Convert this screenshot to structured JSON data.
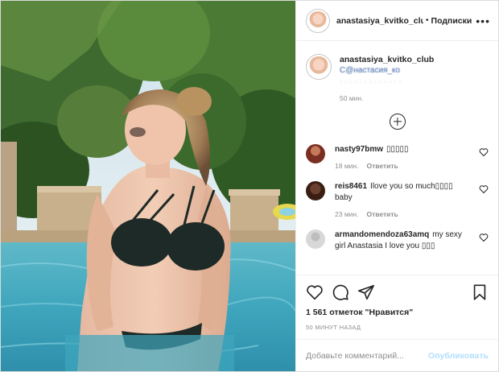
{
  "header": {
    "username": "anastasiya_kvitko_club",
    "separator": "•",
    "follow_label": "Подписки",
    "more_icon": "more-horizontal-icon"
  },
  "caption": {
    "username": "anastasiya_kvitko_club",
    "line1": "С@настасия_ко",
    "line2": "· · · · · · · · · · · · ·",
    "time": "50 мин."
  },
  "load_more_icon": "plus-circle-icon",
  "comments": [
    {
      "user": "nasty97bmw",
      "text": "▯▯▯▯▯",
      "time": "18 мин.",
      "reply": "Ответить",
      "avatar_color": "#7a2f22"
    },
    {
      "user": "reis8461",
      "text": "Ilove you so much▯▯▯▯ baby",
      "time": "23 мин.",
      "reply": "Ответить",
      "avatar_color": "#3b1e12"
    },
    {
      "user": "armandomendoza63amq",
      "text": "my sexy girl Anastasia I love you ▯▯▯",
      "time": "",
      "reply": "",
      "avatar_color": "#d8d8d8"
    }
  ],
  "actions": {
    "like_icon": "heart-icon",
    "comment_icon": "comment-icon",
    "share_icon": "paper-plane-icon",
    "save_icon": "bookmark-icon",
    "likes_text": "1 561 отметок \"Нравится\"",
    "posted_time": "50 МИНУТ НАЗАД"
  },
  "add_comment": {
    "placeholder": "Добавьте комментарий...",
    "publish_label": "Опубликовать"
  },
  "colors": {
    "link_blue": "#3a63a8",
    "publish_disabled": "#b2dffc",
    "meta_grey": "#8e8e8e"
  }
}
